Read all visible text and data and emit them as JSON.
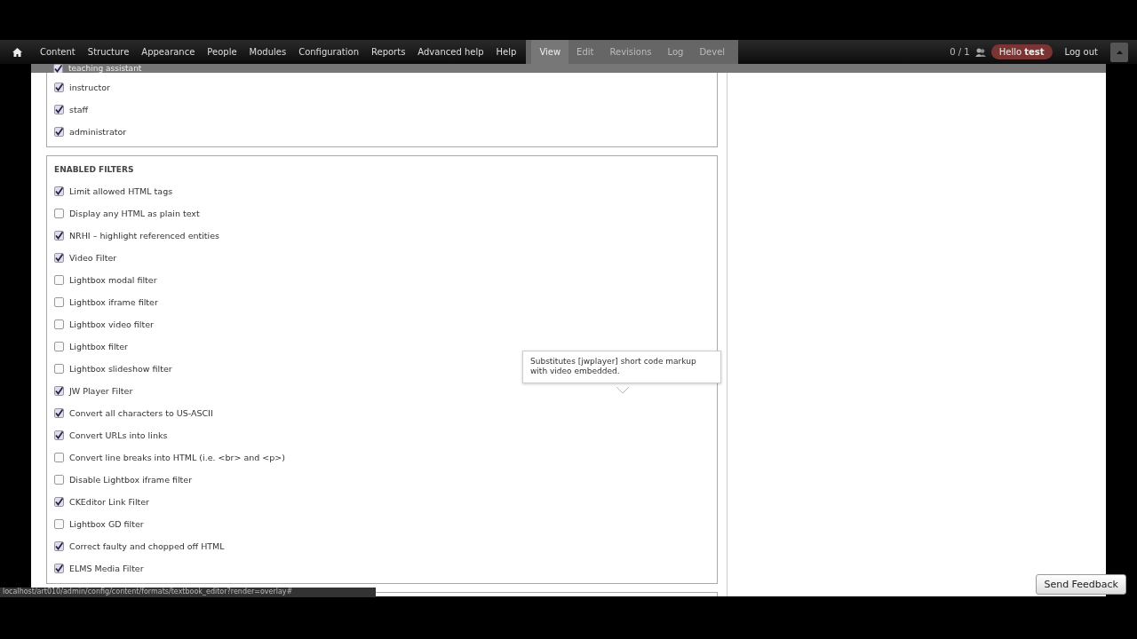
{
  "toolbar": {
    "menu": [
      {
        "label": "Content"
      },
      {
        "label": "Structure"
      },
      {
        "label": "Appearance"
      },
      {
        "label": "People"
      },
      {
        "label": "Modules"
      },
      {
        "label": "Configuration"
      },
      {
        "label": "Reports"
      },
      {
        "label": "Advanced help"
      },
      {
        "label": "Help"
      }
    ],
    "tabs": [
      {
        "label": "View",
        "selected": true
      },
      {
        "label": "Edit",
        "selected": false
      },
      {
        "label": "Revisions",
        "selected": false
      },
      {
        "label": "Log",
        "selected": false
      },
      {
        "label": "Devel",
        "selected": false
      }
    ],
    "users_online": "0 / 1",
    "greeting_prefix": "Hello",
    "greeting_user": "test",
    "logout": "Log out"
  },
  "roles": [
    {
      "label": "teaching assistant",
      "checked": true
    },
    {
      "label": "instructor",
      "checked": true
    },
    {
      "label": "staff",
      "checked": true
    },
    {
      "label": "administrator",
      "checked": true
    }
  ],
  "enabled_filters": {
    "title": "ENABLED FILTERS",
    "items": [
      {
        "label": "Limit allowed HTML tags",
        "checked": true
      },
      {
        "label": "Display any HTML as plain text",
        "checked": false
      },
      {
        "label": "NRHI – highlight referenced entities",
        "checked": true
      },
      {
        "label": "Video Filter",
        "checked": true
      },
      {
        "label": "Lightbox modal filter",
        "checked": false
      },
      {
        "label": "Lightbox iframe filter",
        "checked": false
      },
      {
        "label": "Lightbox video filter",
        "checked": false
      },
      {
        "label": "Lightbox filter",
        "checked": false
      },
      {
        "label": "Lightbox slideshow filter",
        "checked": false
      },
      {
        "label": "JW Player Filter",
        "checked": true
      },
      {
        "label": "Convert all characters to US-ASCII",
        "checked": true
      },
      {
        "label": "Convert URLs into links",
        "checked": true
      },
      {
        "label": "Convert line breaks into HTML (i.e. <br> and <p>)",
        "checked": false
      },
      {
        "label": "Disable Lightbox iframe filter",
        "checked": false
      },
      {
        "label": "CKEditor Link Filter",
        "checked": true
      },
      {
        "label": "Lightbox GD filter",
        "checked": false
      },
      {
        "label": "Correct faulty and chopped off HTML",
        "checked": true
      },
      {
        "label": "ELMS Media Filter",
        "checked": true
      }
    ]
  },
  "tooltip": "Substitutes [jwplayer] short code markup with video embedded.",
  "status_url": "localhost/art010/admin/config/content/formats/textbook_editor?render=overlay#",
  "feedback_button": "Send Feedback"
}
